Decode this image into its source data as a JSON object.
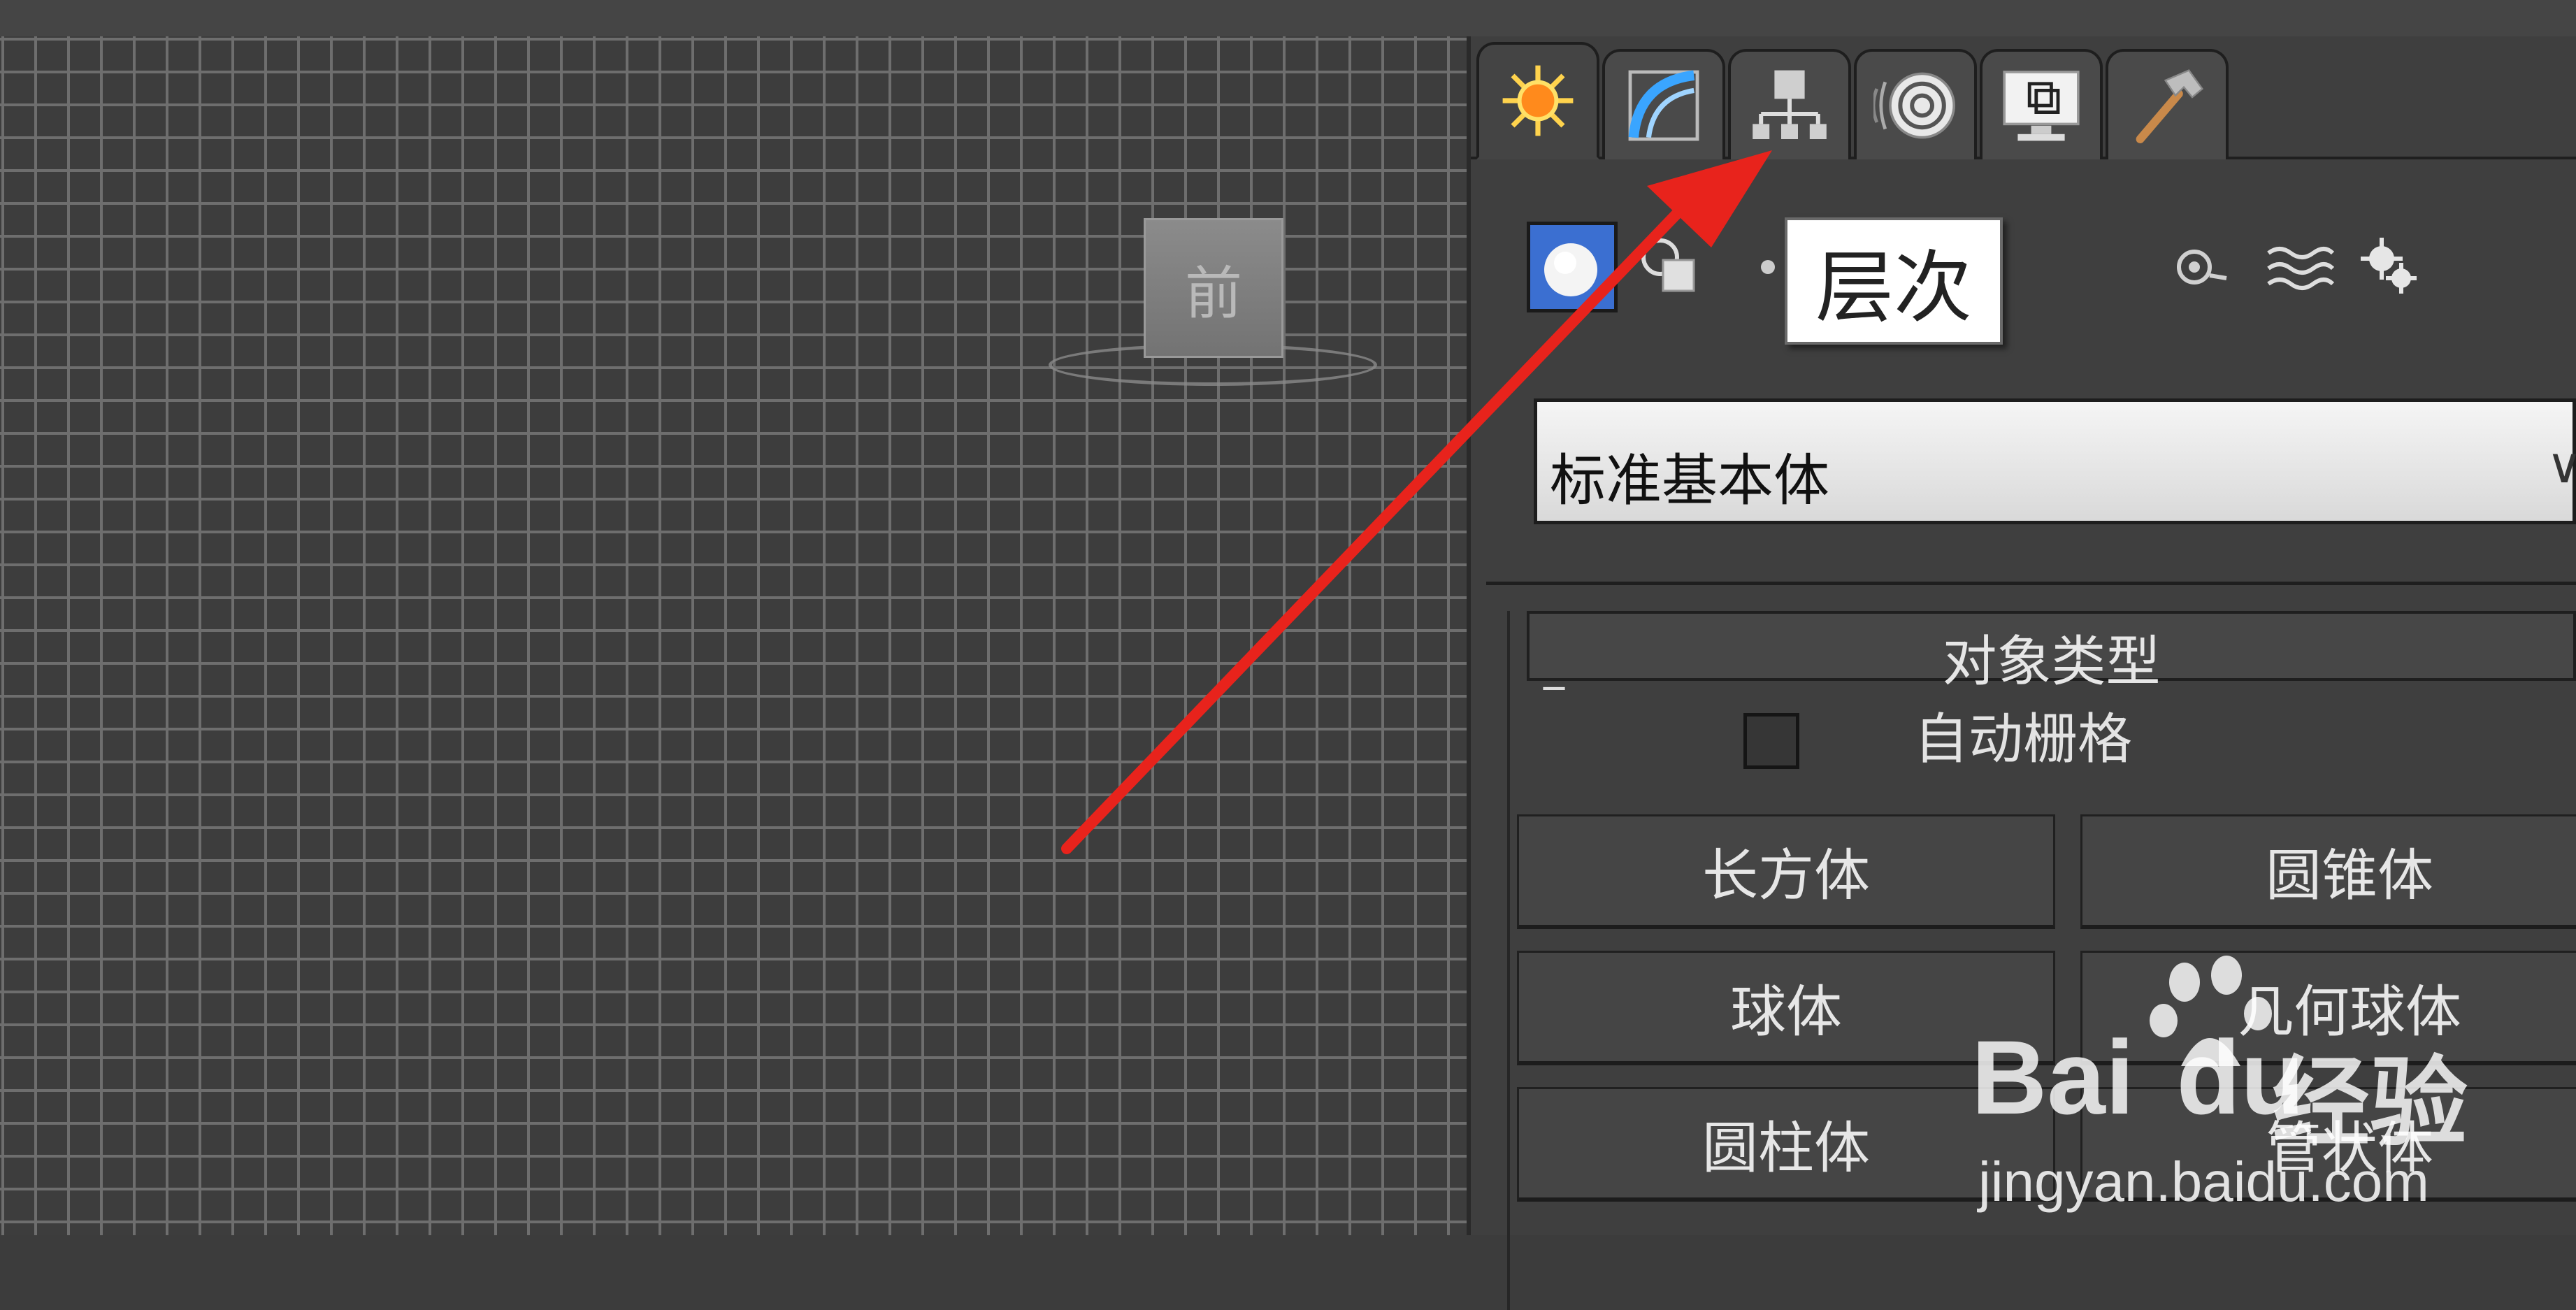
{
  "command_panel": {
    "tabs": [
      {
        "name": "create",
        "icon": "create-sun-icon",
        "active": true
      },
      {
        "name": "modify",
        "icon": "modify-arc-icon"
      },
      {
        "name": "hierarchy",
        "icon": "hierarchy-icon"
      },
      {
        "name": "motion",
        "icon": "motion-icon"
      },
      {
        "name": "display",
        "icon": "display-monitor-icon"
      },
      {
        "name": "utilities",
        "icon": "utilities-hammer-icon"
      }
    ],
    "tooltip": "层次",
    "category_icons": [
      "geometry-sphere-icon",
      "shapes-icon",
      "lights-icon",
      "cameras-icon",
      "helpers-icon",
      "space-warps-icon",
      "systems-icon"
    ],
    "dropdown_value": "标准基本体",
    "dropdown_arrow": "∨",
    "rollout": {
      "collapse_symbol": "_",
      "title": "对象类型",
      "autogrid_label": "自动栅格",
      "buttons": [
        "长方体",
        "圆锥体",
        "球体",
        "几何球体",
        "圆柱体",
        "管状体"
      ]
    }
  },
  "viewport": {
    "viewcube_label": "前"
  },
  "watermark": {
    "brand": "Bai",
    "brand_du": "du",
    "name": "经验",
    "url": "jingyan.baidu.com"
  },
  "colors": {
    "accent_blue": "#3b6fd1",
    "annotation_red": "#e8231c"
  }
}
